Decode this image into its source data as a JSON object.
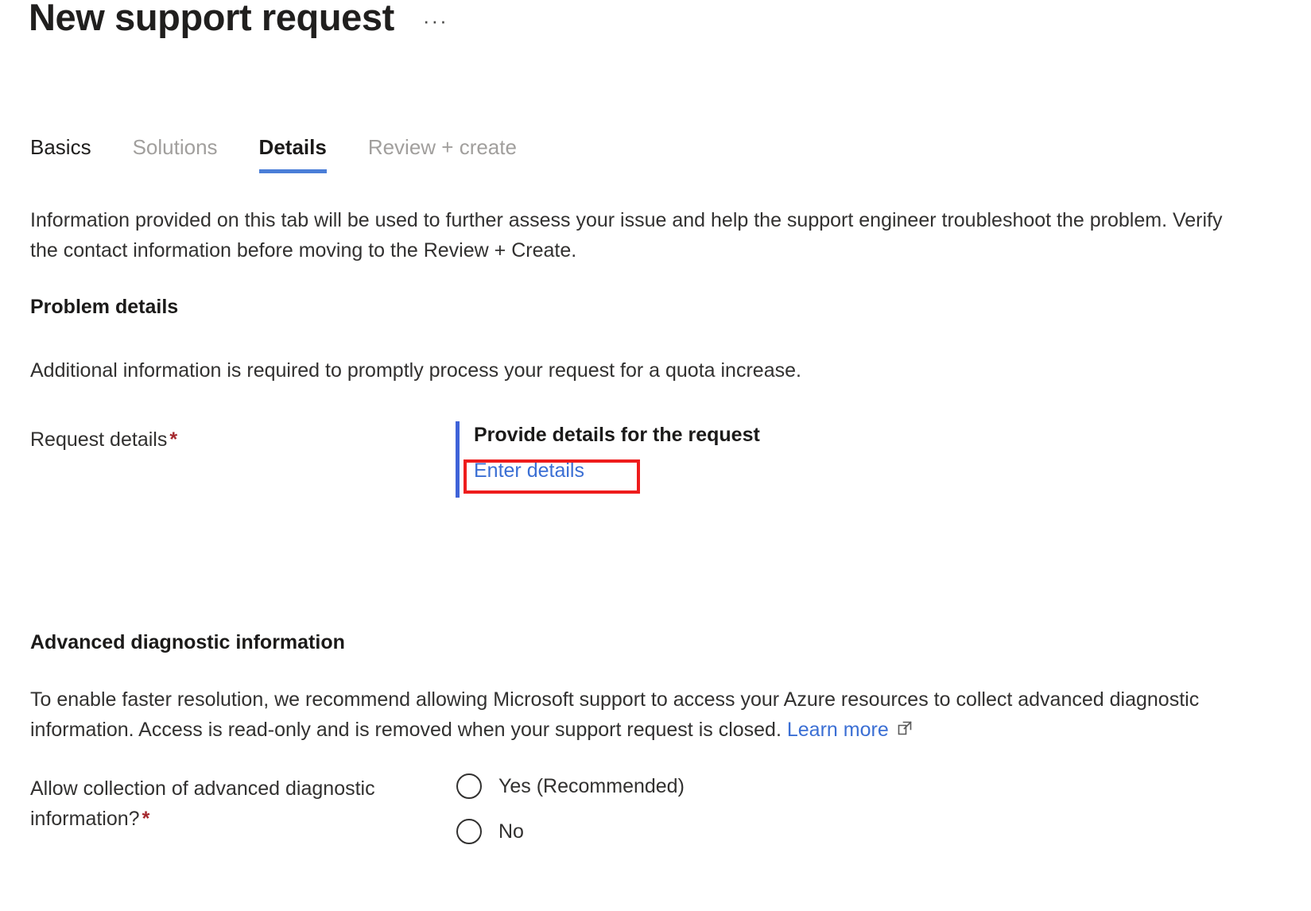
{
  "header": {
    "title": "New support request",
    "more_actions_label": "···"
  },
  "tabs": [
    {
      "label": "Basics",
      "state": "enabled"
    },
    {
      "label": "Solutions",
      "state": "disabled"
    },
    {
      "label": "Details",
      "state": "selected"
    },
    {
      "label": "Review + create",
      "state": "disabled"
    }
  ],
  "intro_text": "Information provided on this tab will be used to further assess your issue and help the support engineer troubleshoot the problem. Verify the contact information before moving to the Review + Create.",
  "problem_details": {
    "heading": "Problem details",
    "paragraph": "Additional information is required to promptly process your request for a quota increase.",
    "request_details_label": "Request details",
    "required_marker": "*",
    "callout": {
      "title": "Provide details for the request",
      "link_label": "Enter details"
    }
  },
  "advanced_diagnostics": {
    "heading": "Advanced diagnostic information",
    "paragraph_part1": "To enable faster resolution, we recommend allowing Microsoft support to access your Azure resources to collect advanced diagnostic information. Access is read-only and is removed when your support request is closed.",
    "learn_more_label": "Learn more",
    "allow_collection_label": "Allow collection of advanced diagnostic information?",
    "required_marker": "*",
    "options": [
      {
        "label": "Yes (Recommended)",
        "checked": false
      },
      {
        "label": "No",
        "checked": false
      }
    ]
  },
  "colors": {
    "accent_blue": "#0078d4",
    "tab_underline": "#4a7ed8",
    "link_blue": "#3b6fd4",
    "callout_bar": "#3f63d8",
    "required_red": "#a4262c",
    "annotation_red": "#ee1c1c",
    "text_primary": "#323130",
    "text_disabled": "#a19f9d",
    "background": "#ffffff"
  }
}
